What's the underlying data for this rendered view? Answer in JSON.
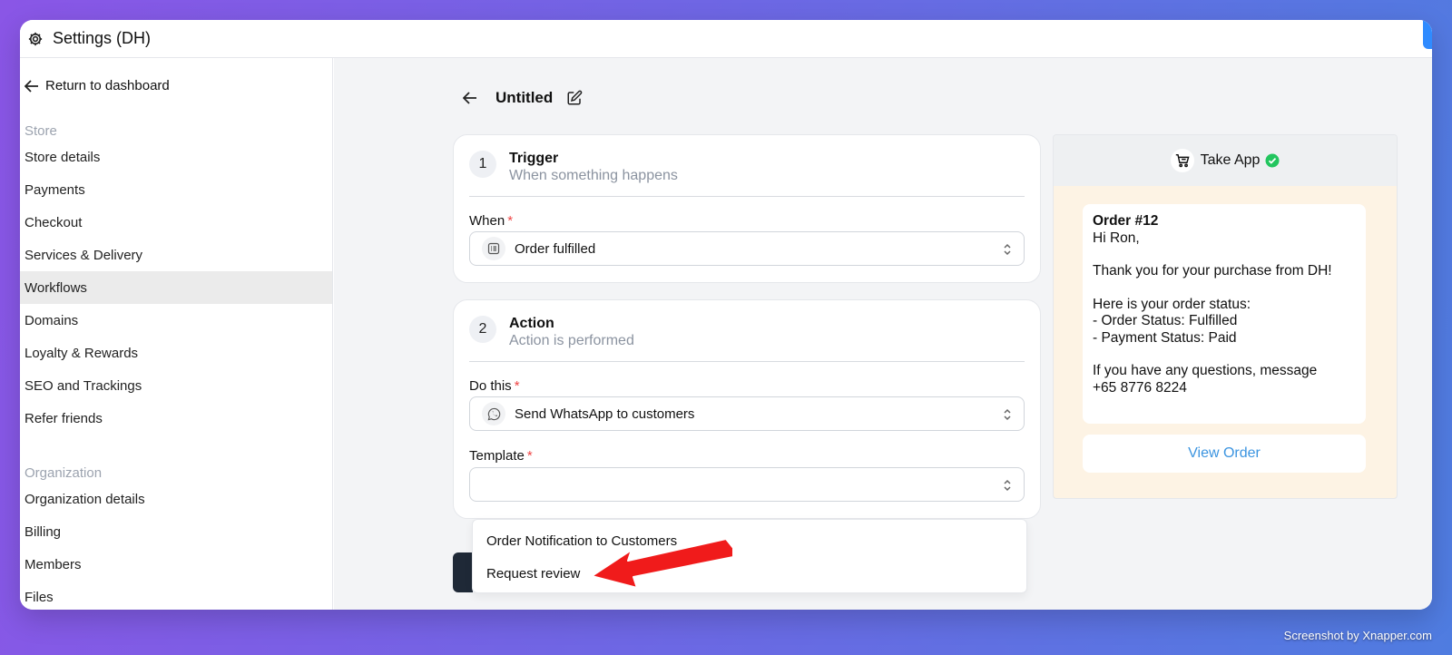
{
  "window": {
    "title": "Settings (DH)"
  },
  "sidebar": {
    "return_label": "Return to dashboard",
    "store_section": "Store",
    "store_items": [
      {
        "label": "Store details",
        "active": false
      },
      {
        "label": "Payments",
        "active": false
      },
      {
        "label": "Checkout",
        "active": false
      },
      {
        "label": "Services & Delivery",
        "active": false
      },
      {
        "label": "Workflows",
        "active": true
      },
      {
        "label": "Domains",
        "active": false
      },
      {
        "label": "Loyalty & Rewards",
        "active": false
      },
      {
        "label": "SEO and Trackings",
        "active": false
      },
      {
        "label": "Refer friends",
        "active": false
      }
    ],
    "org_section": "Organization",
    "org_items": [
      {
        "label": "Organization details"
      },
      {
        "label": "Billing"
      },
      {
        "label": "Members"
      },
      {
        "label": "Files"
      }
    ]
  },
  "workflow": {
    "title": "Untitled",
    "trigger": {
      "number": "1",
      "title": "Trigger",
      "subtitle": "When something happens",
      "when_label": "When",
      "when_value": "Order fulfilled"
    },
    "action": {
      "number": "2",
      "title": "Action",
      "subtitle": "Action is performed",
      "do_label": "Do this",
      "do_value": "Send WhatsApp to customers",
      "template_label": "Template",
      "template_value": ""
    },
    "required_mark": "*",
    "template_options": [
      "Order Notification to Customers",
      "Request review"
    ]
  },
  "preview": {
    "app_name": "Take App",
    "message": {
      "order_title": "Order #12",
      "greeting": "Hi Ron,",
      "thanks": "Thank you for your purchase from DH!",
      "status_intro": "Here is your order status:",
      "order_status": "- Order Status: Fulfilled",
      "payment_status": "- Payment Status: Paid",
      "questions": "If you have any questions, message",
      "phone": "+65 8776 8224"
    },
    "view_button": "View Order"
  },
  "watermark": "Screenshot by Xnapper.com",
  "colors": {
    "accent_blue": "#3b94e0",
    "required_red": "#ef4444",
    "annotation_red": "#f01b1b",
    "verified_green": "#22c55e"
  }
}
